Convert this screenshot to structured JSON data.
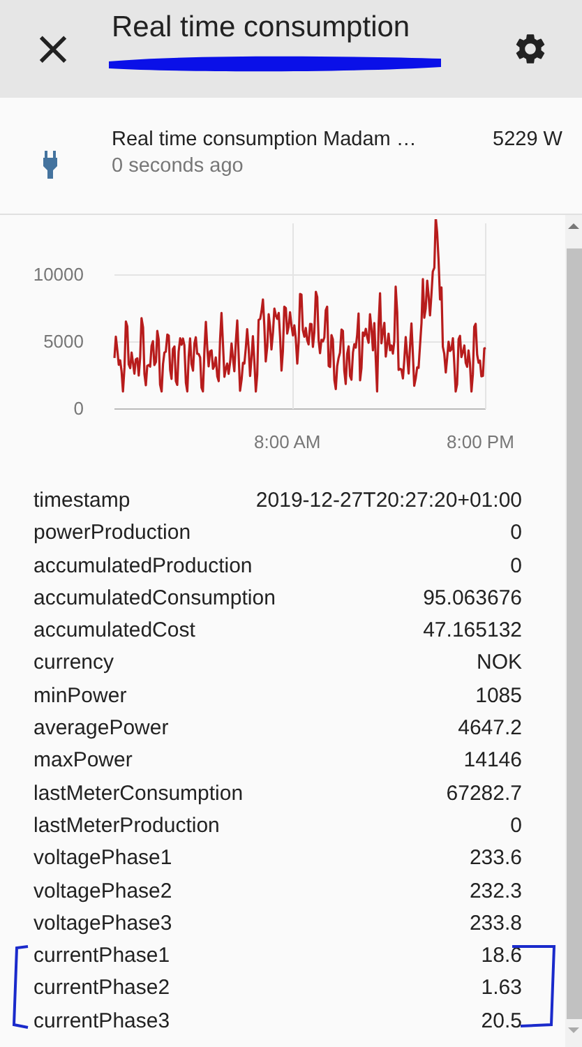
{
  "header": {
    "close": "×",
    "title": "Real time consumption"
  },
  "entity": {
    "name": "Real time consumption Madam …",
    "updated": "0 seconds ago",
    "state": "5229 W"
  },
  "chart": {
    "yticks": [
      "10000",
      "5000",
      "0"
    ],
    "xticks": [
      "8:00 AM",
      "8:00 PM"
    ]
  },
  "attributes": [
    {
      "name": "timestamp",
      "value": "2019-12-27T20:27:20+01:00"
    },
    {
      "name": "powerProduction",
      "value": "0"
    },
    {
      "name": "accumulatedProduction",
      "value": "0"
    },
    {
      "name": "accumulatedConsumption",
      "value": "95.063676"
    },
    {
      "name": "accumulatedCost",
      "value": "47.165132"
    },
    {
      "name": "currency",
      "value": "NOK"
    },
    {
      "name": "minPower",
      "value": "1085"
    },
    {
      "name": "averagePower",
      "value": "4647.2"
    },
    {
      "name": "maxPower",
      "value": "14146"
    },
    {
      "name": "lastMeterConsumption",
      "value": "67282.7"
    },
    {
      "name": "lastMeterProduction",
      "value": "0"
    },
    {
      "name": "voltagePhase1",
      "value": "233.6"
    },
    {
      "name": "voltagePhase2",
      "value": "232.3"
    },
    {
      "name": "voltagePhase3",
      "value": "233.8"
    },
    {
      "name": "currentPhase1",
      "value": "18.6"
    },
    {
      "name": "currentPhase2",
      "value": "1.63"
    },
    {
      "name": "currentPhase3",
      "value": "20.5"
    }
  ]
}
